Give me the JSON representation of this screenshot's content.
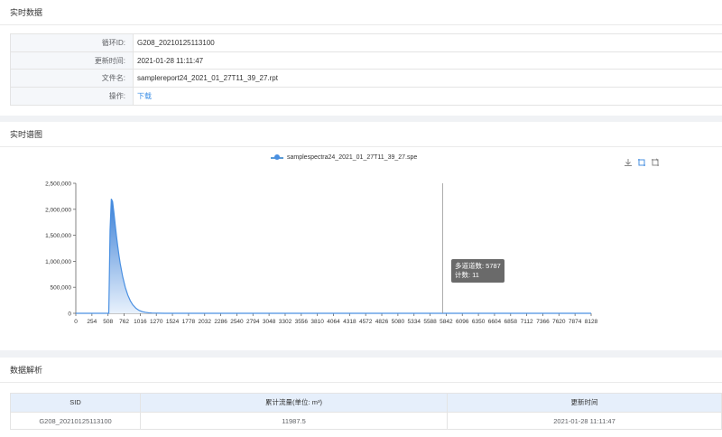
{
  "realtime": {
    "title": "实时数据",
    "rows": [
      {
        "label": "循环ID:",
        "value": "G208_20210125113100"
      },
      {
        "label": "更新时间:",
        "value": "2021-01-28 11:11:47"
      },
      {
        "label": "文件名:",
        "value": "samplereport24_2021_01_27T11_39_27.rpt"
      },
      {
        "label": "操作:",
        "value": "下载"
      }
    ]
  },
  "spectrum": {
    "title": "实时谱图",
    "toolbox": [
      "download-icon",
      "zoom-icon",
      "zoom-reset-icon"
    ],
    "tooltip": {
      "line1": "多道道数: 5787",
      "line2": "计数: 11"
    }
  },
  "chart_data": {
    "type": "area",
    "legend": [
      "samplespectra24_2021_01_27T11_39_27.spe"
    ],
    "legend_position": "top-center",
    "xlim": [
      0,
      8128
    ],
    "ylim": [
      0,
      2500000
    ],
    "x_tick_labels": [
      "0",
      "254",
      "508",
      "762",
      "1016",
      "1270",
      "1524",
      "1778",
      "2032",
      "2286",
      "2540",
      "2794",
      "3048",
      "3302",
      "3556",
      "3810",
      "4064",
      "4318",
      "4572",
      "4826",
      "5080",
      "5334",
      "5588",
      "5842",
      "6096",
      "6350",
      "6604",
      "6858",
      "7112",
      "7366",
      "7620",
      "7874",
      "8128"
    ],
    "y_tick_labels": [
      "0",
      "500,000",
      "1,000,000",
      "1,500,000",
      "2,000,000",
      "2,500,000"
    ],
    "series": [
      {
        "name": "samplespectra24_2021_01_27T11_39_27.spe",
        "color": "#4a90e2",
        "x": [
          0,
          520,
          540,
          560,
          580,
          600,
          620,
          640,
          660,
          680,
          700,
          740,
          780,
          820,
          860,
          900,
          950,
          1000,
          1050,
          1100,
          1150,
          1200,
          1250,
          1300,
          1400,
          1600,
          2000,
          3000,
          5787,
          8128
        ],
        "y": [
          0,
          0,
          1600000,
          2200000,
          2150000,
          1950000,
          1720000,
          1500000,
          1300000,
          1120000,
          960000,
          700000,
          500000,
          350000,
          240000,
          160000,
          95000,
          55000,
          32000,
          18000,
          10000,
          5500,
          3000,
          1500,
          600,
          200,
          50,
          20,
          11,
          0
        ]
      }
    ],
    "cursor_x": 5787
  },
  "analysis": {
    "title": "数据解析",
    "columns": [
      "SID",
      "累计流量(单位: m³)",
      "更新时间"
    ],
    "rows": [
      [
        "G208_20210125113100",
        "11987.5",
        "2021-01-28 11:11:47"
      ]
    ]
  }
}
